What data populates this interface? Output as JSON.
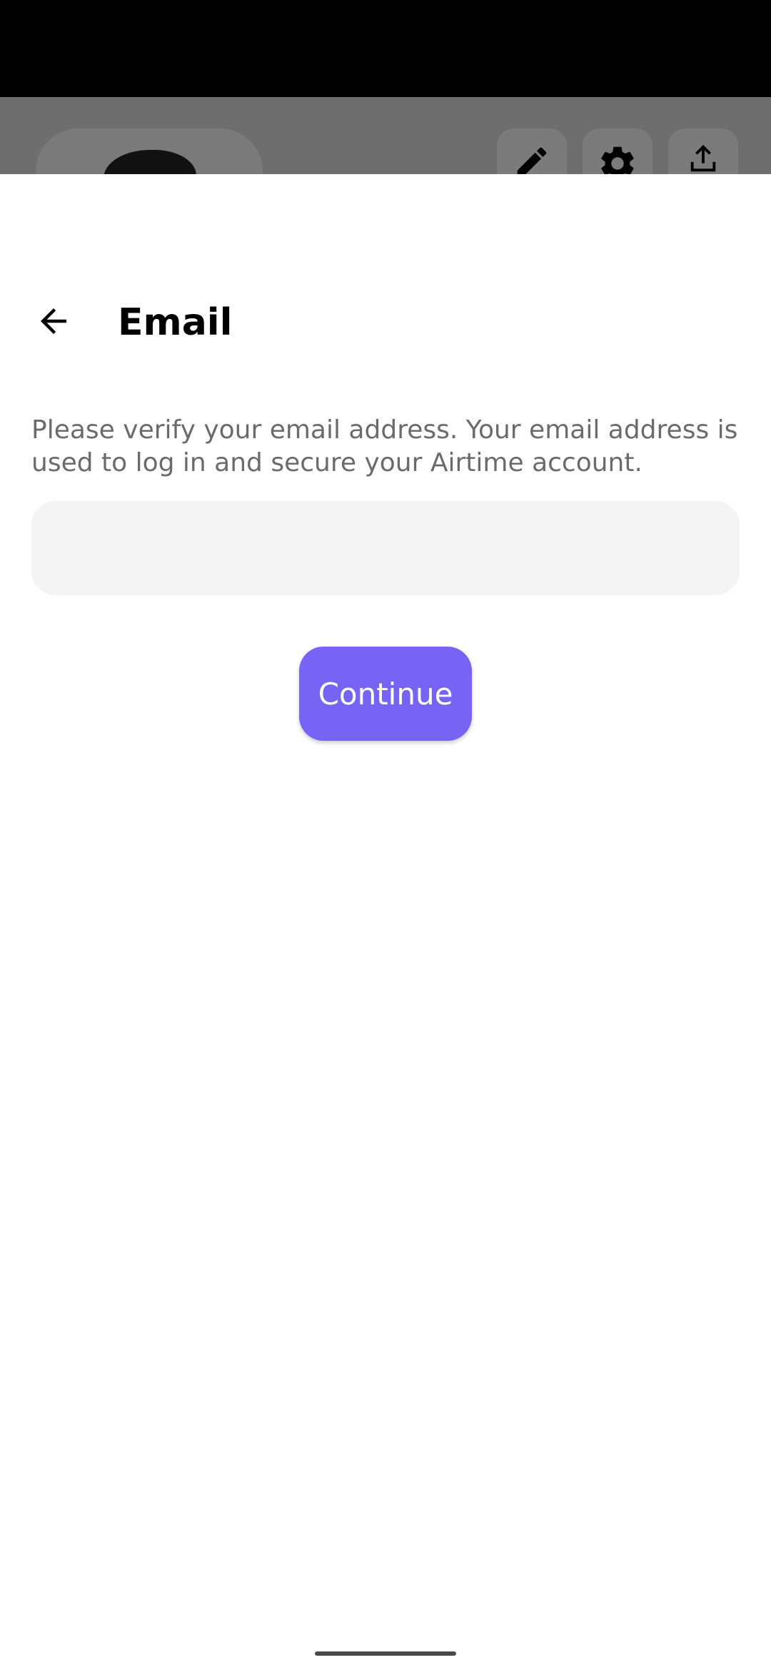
{
  "colors": {
    "accent": "#7764f4",
    "status_bar": "#000000",
    "scrim": "#6e6e6e",
    "input_background": "#f4f4f4",
    "description_text": "#6b6b6b"
  },
  "underlay": {
    "icons": [
      "edit-icon",
      "gear-icon",
      "share-icon"
    ]
  },
  "header": {
    "back_icon": "arrow-left-icon",
    "title": "Email"
  },
  "body": {
    "description": "Please verify your email address. Your email address is used to log in and secure your Airtime account.",
    "email_value": "",
    "email_placeholder": ""
  },
  "actions": {
    "continue_label": "Continue"
  }
}
